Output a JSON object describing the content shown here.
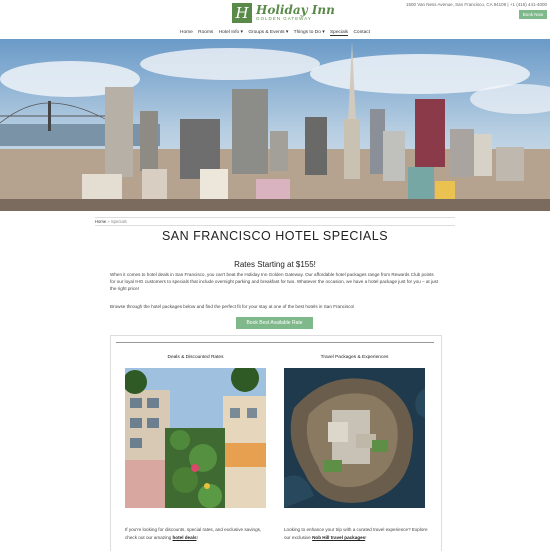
{
  "header": {
    "logo_name": "Holiday Inn",
    "logo_sub": "GOLDEN GATEWAY",
    "contact": "1500 Van Ness Avenue, San Francisco, CA 94109 | +1 (415) 441-4000",
    "book_now": "Book Now"
  },
  "nav": [
    "Home",
    "Rooms",
    "Hotel Info ▾",
    "Groups & Events ▾",
    "Things to Do ▾",
    "Specials",
    "Contact"
  ],
  "nav_active": "Specials",
  "breadcrumb": {
    "home": "Home",
    "separator": "»",
    "current": "Specials"
  },
  "page_title": "SAN FRANCISCO HOTEL SPECIALS",
  "rates_heading": "Rates Starting at $155!",
  "intro": "When it comes to hotel deals in San Francisco, you can't beat the Holiday Inn Golden Gateway. Our affordable hotel packages range from Rewards Club points for our loyal IHG customers to specials that include overnight parking and breakfast for two. Whatever the occasion, we have a hotel package just for you – at just the right price!",
  "browse": "Browse through the hotel packages below and find the perfect fit for your stay at one of the best hotels in San Francisco!",
  "best_rate_button": "Book Best Available Rate",
  "offers": [
    {
      "title": "Deals & Discounted Rates",
      "desc_pre": "If you're looking for discounts, special rates, and exclusive savings, check out our amazing ",
      "link": "hotel deals",
      "desc_post": "!"
    },
    {
      "title": "Travel Packages & Experiences",
      "desc_pre": "Looking to enhance your trip with a curated travel experience? Explore our exclusive ",
      "link": "Nob Hill travel packages",
      "desc_post": "!"
    }
  ],
  "colors": {
    "brand_green": "#5a8a4a",
    "button_green": "#7fb88a"
  }
}
